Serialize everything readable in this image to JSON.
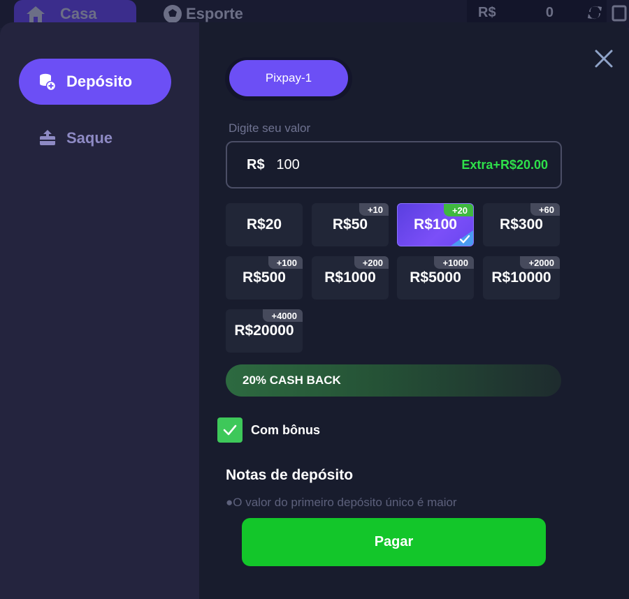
{
  "topbar": {
    "home_label": "Casa",
    "sport_label": "Esporte",
    "currency": "R$",
    "balance": "0"
  },
  "sidebar": {
    "items": [
      {
        "label": "Depósito",
        "icon": "coins-plus-icon",
        "active": true
      },
      {
        "label": "Saque",
        "icon": "withdraw-icon",
        "active": false
      }
    ]
  },
  "deposit": {
    "channel_label": "Pixpay-1",
    "amount_label": "Digite seu valor",
    "currency": "R$",
    "amount_value": "100",
    "extra_text": "Extra+R$20.00",
    "amounts": [
      {
        "label": "R$20",
        "bonus": ""
      },
      {
        "label": "R$50",
        "bonus": "+10"
      },
      {
        "label": "R$100",
        "bonus": "+20",
        "selected": true
      },
      {
        "label": "R$300",
        "bonus": "+60"
      },
      {
        "label": "R$500",
        "bonus": "+100"
      },
      {
        "label": "R$1000",
        "bonus": "+200"
      },
      {
        "label": "R$5000",
        "bonus": "+1000"
      },
      {
        "label": "R$10000",
        "bonus": "+2000"
      },
      {
        "label": "R$20000",
        "bonus": "+4000"
      }
    ],
    "cashback_text": "20% CASH BACK",
    "bonus_label": "Com bônus",
    "bonus_checked": true,
    "notes_title": "Notas de depósito",
    "notes_line": "●O valor do primeiro depósito único é maior",
    "pay_label": "Pagar"
  },
  "colors": {
    "accent": "#6c4ff5",
    "pay": "#13c62a",
    "extra": "#2ee04a"
  }
}
